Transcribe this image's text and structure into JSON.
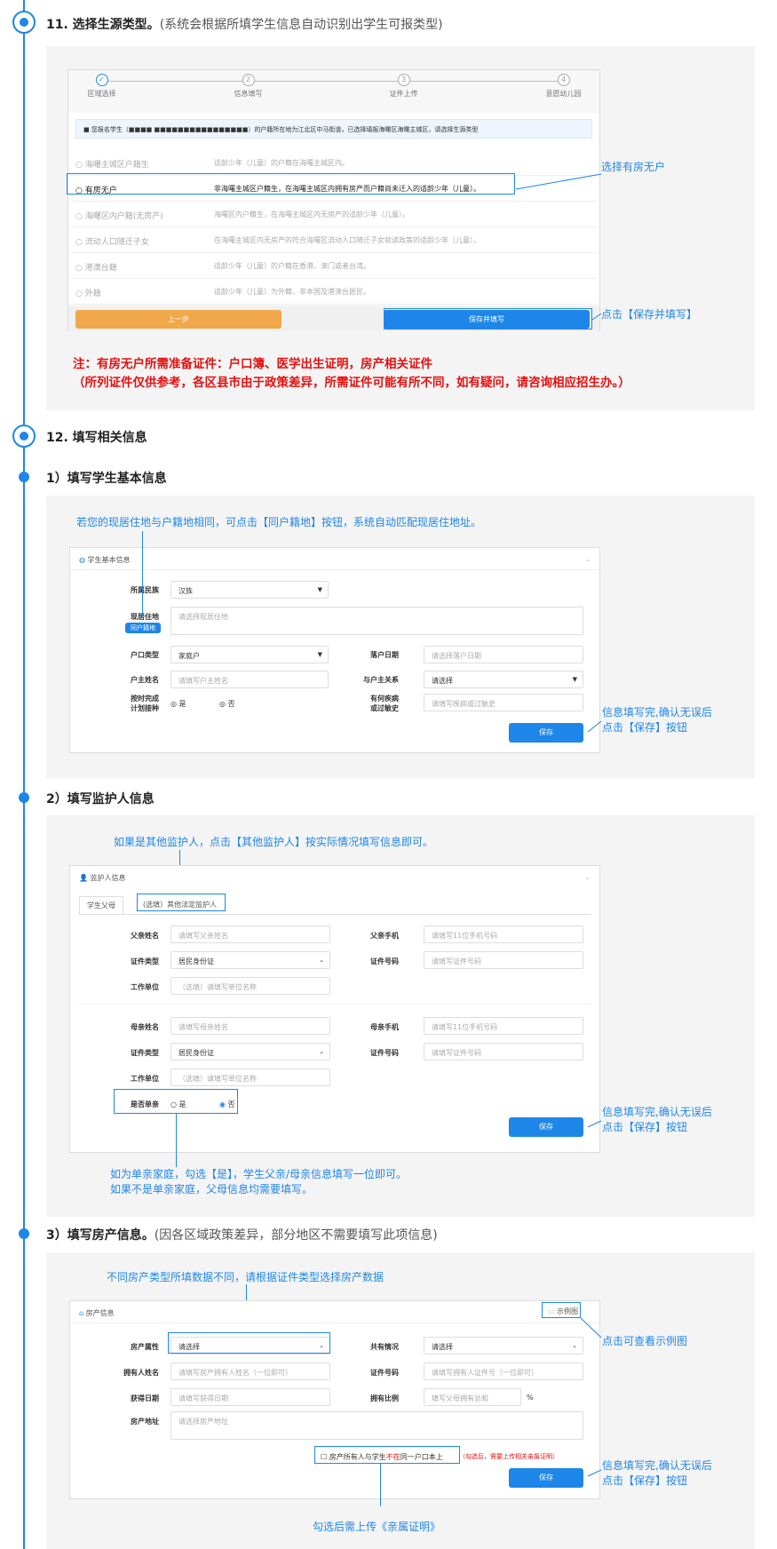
{
  "s11": {
    "title": "11. 选择生源类型。",
    "note": "(系统会根据所填学生信息自动识别出学生可报类型)"
  },
  "step_bar": [
    "区域选择",
    "信息填写",
    "证件上传",
    "意愿幼儿园"
  ],
  "step_nums": [
    "✓",
    "2",
    "3",
    "4"
  ],
  "info_bar": "■ 您报名学生（■■■■ ■■■■■■■■■■■■■■■■）的户籍所在地为江北区中马街道，已选择填报海曙区海曙主城区，请选择生源类型",
  "options": [
    {
      "label": "○ 海曙主城区户籍生",
      "desc": "适龄少年（儿童）的户籍在海曙主城区内。"
    },
    {
      "label": "○ 有房无户",
      "desc": "非海曙主城区户籍生，在海曙主城区内拥有房产而户籍尚未迁入的适龄少年（儿童）。"
    },
    {
      "label": "○ 海曙区内户籍(无房产)",
      "desc": "海曙区内户籍生，在海曙主城区内无房产的适龄少年（儿童）。"
    },
    {
      "label": "○ 流动人口随迁子女",
      "desc": "在海曙主城区内无房产的符合海曙区流动人口随迁子女就读政策的适龄少年（儿童）。"
    },
    {
      "label": "○ 港澳台籍",
      "desc": "适龄少年（儿童）的户籍在香港、澳门或者台湾。"
    },
    {
      "label": "○ 外籍",
      "desc": "适龄少年（儿童）为外籍，非本国及港澳台居民。"
    }
  ],
  "btn_prev": "上一步",
  "btn_save_fill": "保存并填写",
  "ann_select": "选择有房无户",
  "ann_click_save_fill": "点击【保存并填写】",
  "red_note": [
    "注：有房无户所需准备证件：户口簿、医学出生证明，房产相关证件",
    "（所列证件仅供参考，各区县市由于政策差异，所需证件可能有所不同，如有疑问，请咨询相应招生办。）"
  ],
  "s12": {
    "title": "12. 填写相关信息"
  },
  "s12_1": {
    "title": "1）填写学生基本信息"
  },
  "ann_same_addr": "若您的现居住地与户籍地相同，可点击【同户籍地】按钮，系统自动匹配现居住地址。",
  "basic": {
    "panel": "学生基本信息",
    "nation_l": "所属民族",
    "nation_v": "汉族",
    "addr_l": "现居住地",
    "addr_btn": "同户籍地",
    "addr_ph": "请选择现居住地",
    "hk_l": "户口类型",
    "hk_v": "家庭户",
    "date_l": "落户日期",
    "date_ph": "请选择落户日期",
    "owner_l": "户主姓名",
    "owner_ph": "请填写户主姓名",
    "rel_l": "与户主关系",
    "rel_v": "请选择",
    "vac_l": "按时完成\n计划接种",
    "yes": "是",
    "no": "否",
    "dis_l": "有何疾病\n或过敏史",
    "dis_ph": "请填写疾病或过敏史",
    "save": "保存"
  },
  "ann_save": "信息填写完,确认无误后\n点击【保存】按钮",
  "s12_2": {
    "title": "2）填写监护人信息"
  },
  "ann_other_g": "如果是其他监护人，点击【其他监护人】按实际情况填写信息即可。",
  "guard": {
    "panel": "监护人信息",
    "tab1": "学生父母",
    "tab2": "(选填）其他法定监护人",
    "f_name_l": "父亲姓名",
    "f_name_ph": "请填写父亲姓名",
    "f_phone_l": "父亲手机",
    "f_phone_ph": "请填写11位手机号码",
    "id_type_l": "证件类型",
    "id_type_v": "居民身份证",
    "id_no_l": "证件号码",
    "id_no_ph": "请填写证件号码",
    "work_l": "工作单位",
    "work_ph": "（选填）请填写单位名称",
    "m_name_l": "母亲姓名",
    "m_name_ph": "请填写母亲姓名",
    "m_phone_l": "母亲手机",
    "m_phone_ph": "请填写11位手机号码",
    "single_l": "是否单亲",
    "yes": "是",
    "no": "否",
    "save": "保存"
  },
  "ann_single": "如为单亲家庭，勾选【是】，学生父亲/母亲信息填写一位即可。\n如果不是单亲家庭，父母信息均需要填写。",
  "s12_3": {
    "title": "3）填写房产信息。",
    "note": "(因各区域政策差异，部分地区不需要填写此项信息)"
  },
  "ann_house_type": "不同房产类型所填数据不同，请根据证件类型选择房产数据",
  "house": {
    "panel": "房产信息",
    "example": "示例图",
    "prop_l": "房产属性",
    "prop_v": "请选择",
    "share_l": "共有情况",
    "share_v": "请选择",
    "owner_l": "拥有人姓名",
    "owner_ph": "请填写房产拥有人姓名（一位即可）",
    "cert_l": "证件号码",
    "cert_ph": "请填写拥有人证件号（一位即可）",
    "get_l": "获得日期",
    "get_ph": "请填写获得日期",
    "ratio_l": "拥有比例",
    "ratio_ph": "填写父母拥有总和",
    "pct": "%",
    "addr_l": "房产地址",
    "addr_ph": "请选择房产地址",
    "chk_a": "房产所有人与学生",
    "chk_b": "不在",
    "chk_c": "同一户口本上",
    "chk_hint": "（勾选后，需要上传相关亲属证明）",
    "save": "保存"
  },
  "ann_example": "点击可查看示例图",
  "ann_upload": "勾选后需上传《亲属证明》"
}
